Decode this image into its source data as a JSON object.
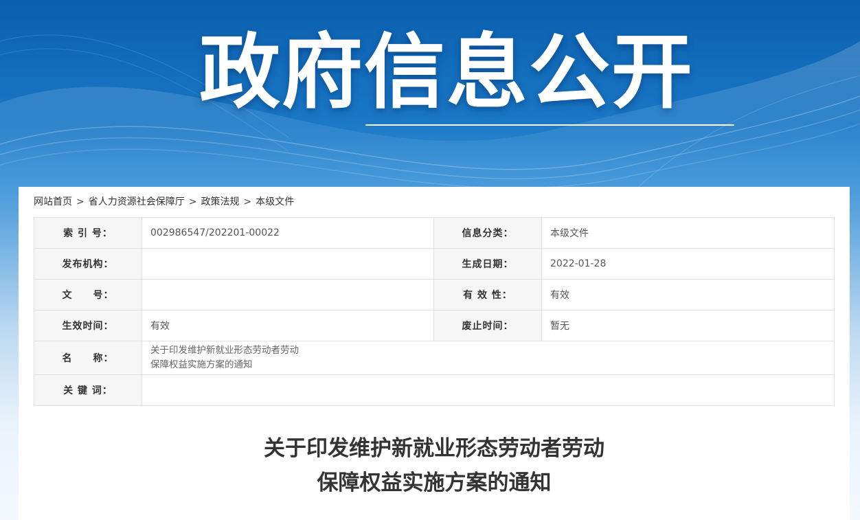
{
  "banner": {
    "title": "政府信息公开"
  },
  "breadcrumb": [
    "网站首页",
    "省人力资源社会保障厅",
    "政策法规",
    "本级文件"
  ],
  "breadcrumb_sep": ">",
  "meta": {
    "index_no_label": "索 引 号：",
    "index_no": "002986547/202201-00022",
    "category_label": "信息分类：",
    "category": "本级文件",
    "publisher_label": "发布机构：",
    "publisher": "",
    "date_label": "生成日期：",
    "date": "2022-01-28",
    "doc_no_label": "文　　号：",
    "doc_no": "",
    "validity_label": "有 效 性：",
    "validity": "有效",
    "effective_label": "生效时间：",
    "effective": "有效",
    "expiry_label": "废止时间：",
    "expiry": "暂无",
    "name_label": "名　　称：",
    "name_line1": "关于印发维护新就业形态劳动者劳动",
    "name_line2": "保障权益实施方案的通知",
    "keywords_label": "关 键 词：",
    "keywords": ""
  },
  "document": {
    "title_line1": "关于印发维护新就业形态劳动者劳动",
    "title_line2": "保障权益实施方案的通知"
  }
}
